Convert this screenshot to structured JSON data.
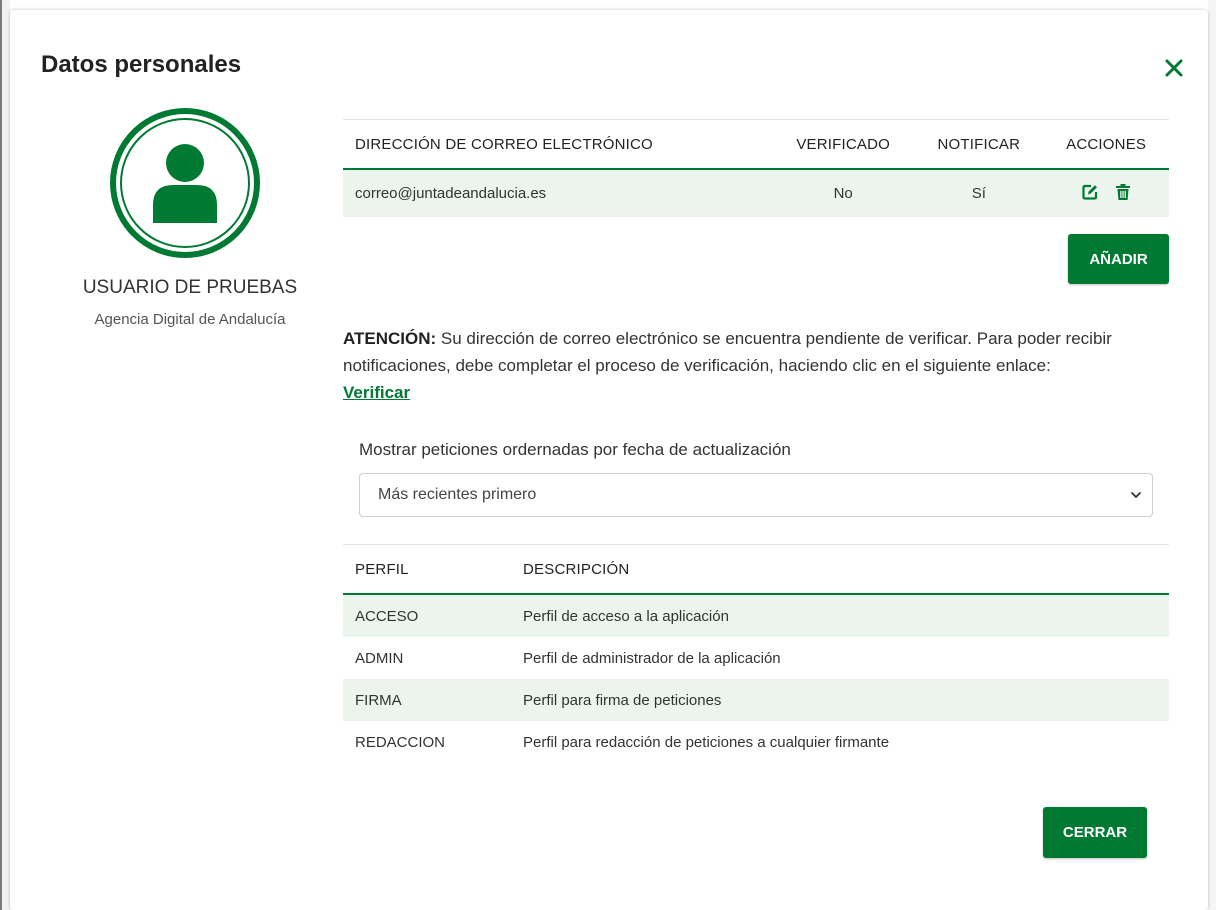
{
  "modal": {
    "title": "Datos personales",
    "close_icon": "close-x-icon"
  },
  "user": {
    "avatar_icon": "user-avatar-icon",
    "name": "USUARIO DE PRUEBAS",
    "organization": "Agencia Digital de Andalucía"
  },
  "email_table": {
    "headers": [
      "DIRECCIÓN DE CORREO ELECTRÓNICO",
      "VERIFICADO",
      "NOTIFICAR",
      "ACCIONES"
    ],
    "rows": [
      {
        "email": "correo@juntadeandalucia.es",
        "verified": "No",
        "notify": "Sí",
        "actions": [
          "edit-icon",
          "trash-icon"
        ]
      }
    ]
  },
  "add_button": "AÑADIR",
  "notice": {
    "label": "ATENCIÓN:",
    "text": " Su dirección de correo electrónico se encuentra pendiente de verificar. Para poder recibir notificaciones, debe completar el proceso de verificación, haciendo clic en el siguiente enlace:",
    "link": "Verificar"
  },
  "sort": {
    "label": "Mostrar peticiones ordernadas por fecha de actualización",
    "selected": "Más recientes primero"
  },
  "profile_table": {
    "headers": [
      "PERFIL",
      "DESCRIPCIÓN"
    ],
    "rows": [
      {
        "perfil": "ACCESO",
        "descripcion": "Perfil de acceso a la aplicación"
      },
      {
        "perfil": "ADMIN",
        "descripcion": "Perfil de administrador de la aplicación"
      },
      {
        "perfil": "FIRMA",
        "descripcion": "Perfil para firma de peticiones"
      },
      {
        "perfil": "REDACCION",
        "descripcion": "Perfil para redacción de peticiones a cualquier firmante"
      }
    ]
  },
  "close_button": "CERRAR",
  "colors": {
    "accent": "#007a33",
    "row_highlight": "#ebf5ed"
  }
}
